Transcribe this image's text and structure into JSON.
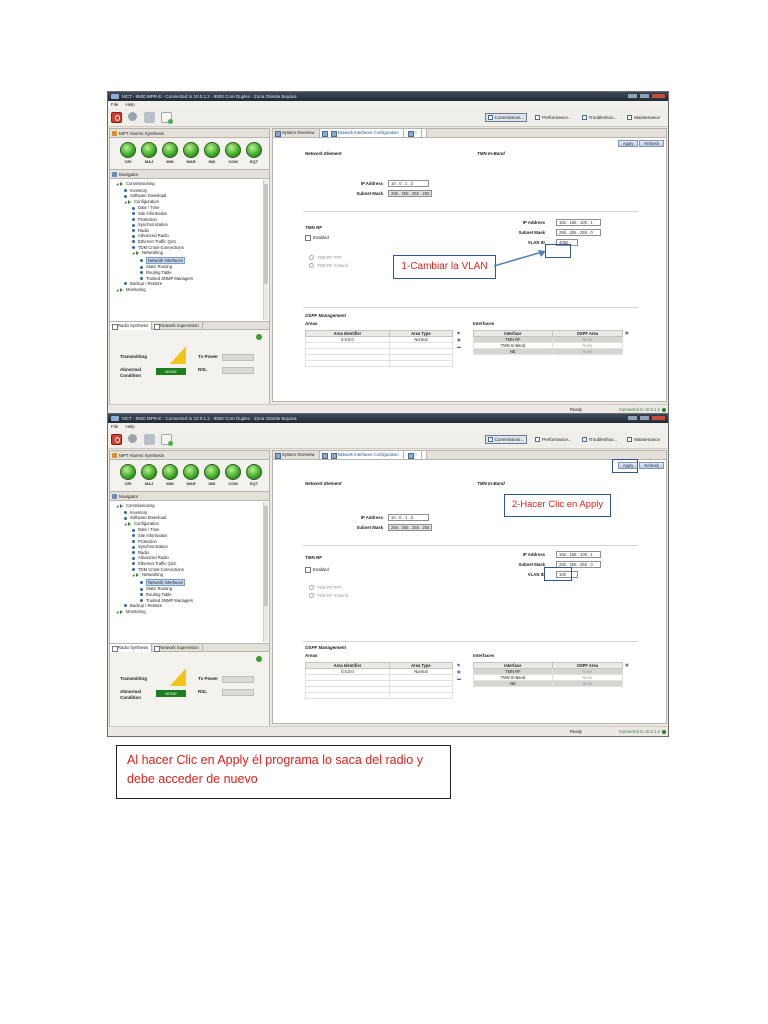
{
  "window": {
    "title": "MCT - 9500 MPR-E - Connected to 10.0.1.2 - 9500 Core Duplex - Zona Oriente Boyaca",
    "menus": [
      "File",
      "Help"
    ],
    "perspectives": [
      "Commissioni...",
      "Performance...",
      "Troubleshoo...",
      "Maintenance"
    ]
  },
  "left": {
    "alarms_title": "MPT Alarms Synthesis",
    "leds": [
      {
        "label": "CRI",
        "count": "0"
      },
      {
        "label": "MAJ",
        "count": "0"
      },
      {
        "label": "MIN",
        "count": "0"
      },
      {
        "label": "WAR",
        "count": "0"
      },
      {
        "label": "IND",
        "count": "0"
      },
      {
        "label": "COM",
        "count": "0"
      },
      {
        "label": "EQT",
        "count": "0"
      }
    ],
    "navigator_title": "Navigator",
    "tree": [
      "Commissioning",
      "Inventory",
      "Software Download",
      "Configuration",
      "Date / Time",
      "Site Information",
      "Protection",
      "Synchronization",
      "Radio",
      "Advanced Radio",
      "Ethernet Traffic QoS",
      "TDM Cross-Connections",
      "Networking",
      "Network Interfaces",
      "Static Routing",
      "Routing Table",
      "Trusted SNMP Managers",
      "Backup / Restore",
      "Monitoring"
    ],
    "bottom_tabs": [
      "Radio Synthesis",
      "Network Supervision"
    ],
    "transmitting": "Transmitting",
    "tx_power": "Tx Power",
    "abnormal": "Abnormal",
    "condition": "Condition",
    "rsl": "RSL",
    "none": "NONE"
  },
  "right": {
    "tabs": [
      "System Overview",
      "Network Interfaces Configuration"
    ],
    "apply": "Apply",
    "refresh": "Refresh",
    "network_element": "Network Element",
    "tmn_inband": "TMN In-Band",
    "ip_address": "IP Address",
    "subnet_mask": "Subnet Mask",
    "ne_ip": "10 . 0 . 1 . 2",
    "ne_mask": "255 . 255 . 255 . 255",
    "tmn_rf": "TMN RF",
    "enabled": "Enabled",
    "tmn_rf_ppp": "TMN RF PPP",
    "tmn_rf_inband": "TMN RF In-Band",
    "vlan_id": "VLAN ID",
    "inband_ip": "192 . 168 . 100 . 1",
    "inband_mask": "255 . 255 . 255 . 0",
    "vlan_before": "4080",
    "vlan_after": "100",
    "ospf": "OSPF Management",
    "areas": "Areas",
    "interfaces": "Interfaces",
    "area_cols": [
      "Area Identifier",
      "Area Type"
    ],
    "area_rows": [
      [
        "0.0.0.0",
        "Normal"
      ]
    ],
    "if_cols": [
      "Interface",
      "OSPF Area"
    ],
    "if_rows": [
      [
        "TMN RF",
        "None"
      ],
      [
        "TMN In-Band",
        "None"
      ],
      [
        "NE",
        "None"
      ]
    ],
    "status_ready": "Ready",
    "status_conn": "Connected to 10.0.1.2"
  },
  "annotations": {
    "step1": "1-Cambiar la VLAN",
    "step2": "2-Hacer Clic en Apply",
    "note": "Al hacer Clic en Apply él programa lo saca del radio y debe acceder de nuevo"
  }
}
